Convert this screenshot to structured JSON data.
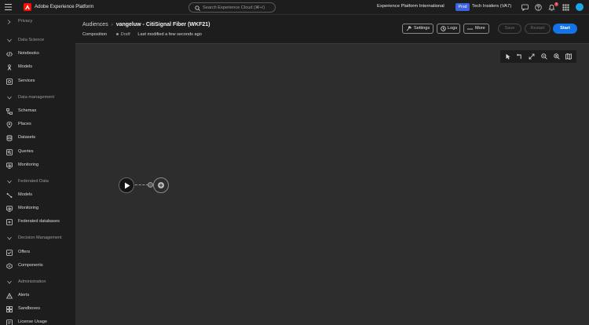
{
  "app": {
    "title": "Adobe Experience Platform",
    "search_placeholder": "Search Experience Cloud (⌘+/)",
    "org": "Experience Platform International",
    "env_badge": "Prod",
    "sandbox": "Tech Insiders (VA7)",
    "notification_count": "7",
    "brand_color": "#fa0f00",
    "accent_color": "#1473e6"
  },
  "sidebar": {
    "items": [
      {
        "label": "Privacy",
        "icon": "chevron-right-icon",
        "kind": "section-collapsed"
      },
      {
        "label": "Data Science",
        "icon": "chevron-down-icon",
        "kind": "section"
      },
      {
        "label": "Notebooks",
        "icon": "code-icon",
        "kind": "item"
      },
      {
        "label": "Models",
        "icon": "model-icon",
        "kind": "item"
      },
      {
        "label": "Services",
        "icon": "services-icon",
        "kind": "item"
      },
      {
        "label": "Data management",
        "icon": "chevron-down-icon",
        "kind": "section"
      },
      {
        "label": "Schemas",
        "icon": "schema-icon",
        "kind": "item"
      },
      {
        "label": "Places",
        "icon": "location-pin-icon",
        "kind": "item"
      },
      {
        "label": "Datasets",
        "icon": "database-icon",
        "kind": "item"
      },
      {
        "label": "Queries",
        "icon": "query-icon",
        "kind": "item"
      },
      {
        "label": "Monitoring",
        "icon": "monitoring-icon",
        "kind": "item"
      },
      {
        "label": "Federated Data",
        "icon": "chevron-down-icon",
        "kind": "section"
      },
      {
        "label": "Models",
        "icon": "federated-model-icon",
        "kind": "item"
      },
      {
        "label": "Monitoring",
        "icon": "monitoring-icon",
        "kind": "item"
      },
      {
        "label": "Federated databases",
        "icon": "federated-database-icon",
        "kind": "item"
      },
      {
        "label": "Decision Management",
        "icon": "chevron-down-icon",
        "kind": "section"
      },
      {
        "label": "Offers",
        "icon": "offers-icon",
        "kind": "item"
      },
      {
        "label": "Components",
        "icon": "components-icon",
        "kind": "item"
      },
      {
        "label": "Administration",
        "icon": "chevron-down-icon",
        "kind": "section"
      },
      {
        "label": "Alerts",
        "icon": "alert-icon",
        "kind": "item"
      },
      {
        "label": "Sandboxes",
        "icon": "sandboxes-icon",
        "kind": "item"
      },
      {
        "label": "License Usage",
        "icon": "license-icon",
        "kind": "item"
      }
    ]
  },
  "header": {
    "breadcrumb_parent": "Audiences",
    "title": "vangeluw - CitiSignal Fiber (WKF21)",
    "type": "Composition",
    "status": "Draft",
    "modified": "Last modified a few seconds ago"
  },
  "actions": {
    "settings": "Settings",
    "logs": "Logs",
    "more": "More",
    "save": "Save",
    "restart": "Restart",
    "start": "Start"
  },
  "canvas_tools": [
    "select-arrow-icon",
    "undo-icon",
    "fit-icon",
    "zoom-out-icon",
    "zoom-in-icon",
    "map-icon"
  ]
}
